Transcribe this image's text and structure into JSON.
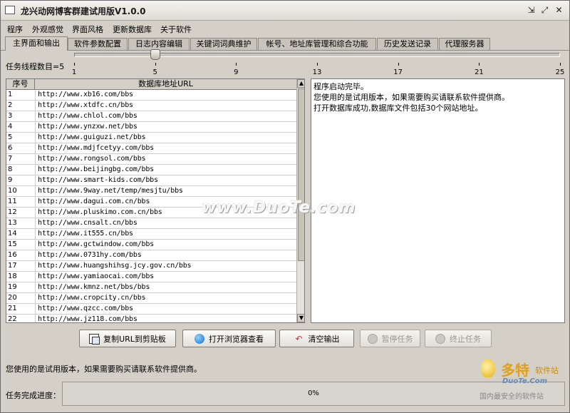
{
  "window": {
    "title": "龙兴动网博客群建试用版V1.0.0",
    "controls": {
      "minimize": "⇲",
      "maximize": "⤢",
      "close": "✕"
    }
  },
  "menu": [
    "程序",
    "外观感觉",
    "界面风格",
    "更新数据库",
    "关于软件"
  ],
  "tabs": [
    {
      "label": "主界面和输出",
      "active": true
    },
    {
      "label": "软件参数配置"
    },
    {
      "label": "日志内容编辑"
    },
    {
      "label": "关键词词典维护"
    },
    {
      "label": "帐号、地址库管理和综合功能"
    },
    {
      "label": "历史发送记录"
    },
    {
      "label": "代理服务器"
    }
  ],
  "thread_slider": {
    "label": "任务线程数目=5",
    "value": 5,
    "min": 1,
    "max": 25,
    "tick_labels": [
      "1",
      "5",
      "9",
      "13",
      "17",
      "21",
      "25"
    ]
  },
  "url_table": {
    "headers": [
      "序号",
      "数据库地址URL"
    ],
    "rows": [
      [
        "1",
        "http://www.xb16.com/bbs"
      ],
      [
        "2",
        "http://www.xtdfc.cn/bbs"
      ],
      [
        "3",
        "http://www.chlol.com/bbs"
      ],
      [
        "4",
        "http://www.ynzxw.net/bbs"
      ],
      [
        "5",
        "http://www.guiguzi.net/bbs"
      ],
      [
        "6",
        "http://www.mdjfcetyy.com/bbs"
      ],
      [
        "7",
        "http://www.rongsol.com/bbs"
      ],
      [
        "8",
        "http://www.beijingbg.com/bbs"
      ],
      [
        "9",
        "http://www.smart-kids.com/bbs"
      ],
      [
        "10",
        "http://www.9way.net/temp/mesjtu/bbs"
      ],
      [
        "11",
        "http://www.dagui.com.cn/bbs"
      ],
      [
        "12",
        "http://www.pluskimo.com.cn/bbs"
      ],
      [
        "13",
        "http://www.cnsalt.cn/bbs"
      ],
      [
        "14",
        "http://www.it555.cn/bbs"
      ],
      [
        "15",
        "http://www.gctwindow.com/bbs"
      ],
      [
        "16",
        "http://www.0731hy.com/bbs"
      ],
      [
        "17",
        "http://www.huangshihsg.jcy.gov.cn/bbs"
      ],
      [
        "18",
        "http://www.yamiaocai.com/bbs"
      ],
      [
        "19",
        "http://www.kmnz.net/bbs/bbs"
      ],
      [
        "20",
        "http://www.cropcity.cn/bbs"
      ],
      [
        "21",
        "http://www.qzcc.com/bbs"
      ],
      [
        "22",
        "http://www.jz118.com/bbs"
      ]
    ]
  },
  "log": [
    "程序启动完毕。",
    "您使用的是试用版本，如果需要购买请联系软件提供商。",
    "打开数据库成功,数据库文件包括30个网站地址。"
  ],
  "buttons": {
    "copy": "复制URL到剪贴板",
    "open_browser": "打开浏览器查看",
    "clear_output": "清空输出",
    "pause_task": "暂停任务",
    "stop_task": "终止任务"
  },
  "status_message": "您使用的是试用版本，如果需要购买请联系软件提供商。",
  "progress": {
    "label": "任务完成进度：",
    "value": 0,
    "text": "0%"
  },
  "watermarks": {
    "center": "www.DuoTe.com",
    "corner_logo": "多特",
    "corner_logo_sub": "软件站",
    "corner_brand": "DuoTe.Com",
    "corner_tagline": "国内最安全的软件站"
  }
}
